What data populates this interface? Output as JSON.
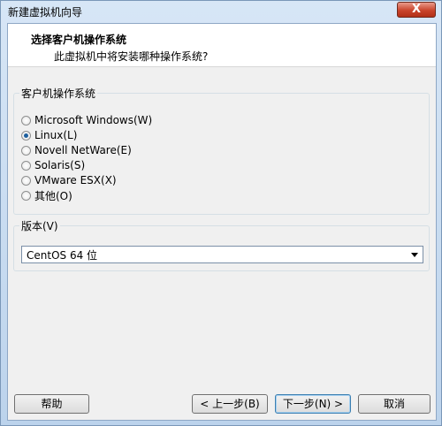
{
  "window": {
    "title": "新建虚拟机向导",
    "close_glyph": "X"
  },
  "header": {
    "title": "选择客户机操作系统",
    "subtitle": "此虚拟机中将安装哪种操作系统?"
  },
  "os_group": {
    "title": "客户机操作系统",
    "options": [
      {
        "label": "Microsoft Windows(W)",
        "checked": false
      },
      {
        "label": "Linux(L)",
        "checked": true
      },
      {
        "label": "Novell NetWare(E)",
        "checked": false
      },
      {
        "label": "Solaris(S)",
        "checked": false
      },
      {
        "label": "VMware ESX(X)",
        "checked": false
      },
      {
        "label": "其他(O)",
        "checked": false
      }
    ]
  },
  "version_group": {
    "title": "版本(V)",
    "selected": "CentOS 64 位"
  },
  "buttons": {
    "help": "帮助",
    "back": "< 上一步(B)",
    "next": "下一步(N) >",
    "cancel": "取消"
  },
  "colors": {
    "accent": "#1d5f9e",
    "close_red": "#c9442b"
  }
}
